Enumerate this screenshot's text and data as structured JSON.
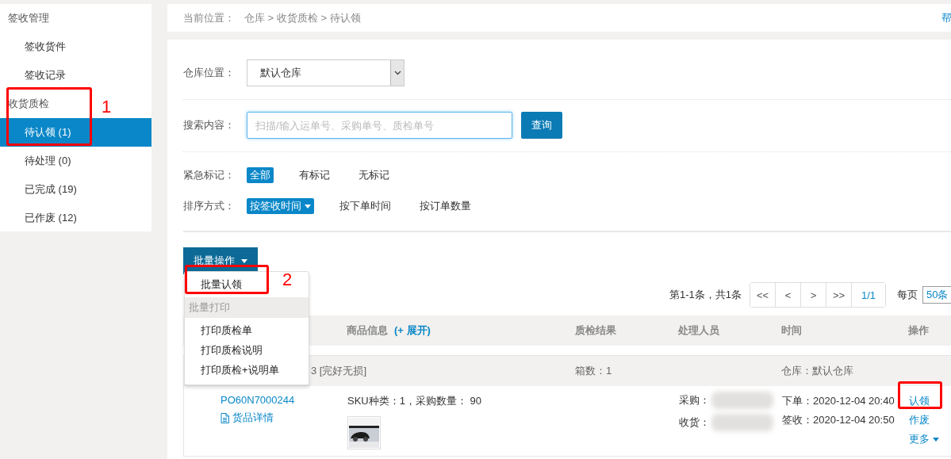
{
  "sidebar": {
    "sections": [
      {
        "title": "签收管理",
        "items": [
          {
            "label": "签收货件",
            "selected": false
          },
          {
            "label": "签收记录",
            "selected": false
          }
        ]
      },
      {
        "title": "收货质检",
        "items": [
          {
            "label": "待认领 (1)",
            "selected": true
          },
          {
            "label": "待处理 (0)",
            "selected": false
          },
          {
            "label": "已完成 (19)",
            "selected": false
          },
          {
            "label": "已作废 (12)",
            "selected": false
          }
        ]
      }
    ]
  },
  "breadcrumb": {
    "label": "当前位置：",
    "path": "仓库 > 收货质检 > 待认领",
    "help": "帮"
  },
  "filters": {
    "warehouse": {
      "label": "仓库位置：",
      "value": "默认仓库"
    },
    "search": {
      "label": "搜索内容：",
      "placeholder": "扫描/输入运单号、采购单号、质检单号",
      "button": "查询"
    },
    "urgent": {
      "label": "紧急标记：",
      "options": [
        {
          "label": "全部",
          "selected": true
        },
        {
          "label": "有标记",
          "selected": false
        },
        {
          "label": "无标记",
          "selected": false
        }
      ]
    },
    "sort": {
      "label": "排序方式：",
      "options": [
        {
          "label": "按签收时间",
          "selected": true
        },
        {
          "label": "按下单时间",
          "selected": false
        },
        {
          "label": "按订单数量",
          "selected": false
        }
      ]
    }
  },
  "batch": {
    "button": "批量操作",
    "menu": [
      {
        "kind": "item",
        "label": "批量认领"
      },
      {
        "kind": "group",
        "label": "批量打印"
      },
      {
        "kind": "item",
        "label": "打印质检单"
      },
      {
        "kind": "item",
        "label": "打印质检说明"
      },
      {
        "kind": "item",
        "label": "打印质检+说明单"
      }
    ]
  },
  "pagination": {
    "summary": "第1-1条，共1条",
    "buttons": [
      "<<",
      "<",
      ">",
      ">>"
    ],
    "page": "1/1",
    "per_page_label": "每页",
    "per_page": "50条"
  },
  "table": {
    "columns": [
      "商品信息",
      "质检结果",
      "处理人员",
      "时间",
      "操作"
    ],
    "expand": "(+ 展开)",
    "groups": [
      {
        "status": "3  [完好无损]",
        "boxes": "箱数：1",
        "warehouse": "仓库：默认仓库",
        "rows": [
          {
            "order": "PO60N7000244",
            "details": "货品详情",
            "sku": "SKU种类：1，采购数量： 90",
            "buyer_label": "采购：",
            "receiver_label": "收货：",
            "ordered": "下单：2020-12-04 20:40",
            "signed": "签收：2020-12-04 20:50",
            "actions": [
              "认领",
              "作废",
              "更多"
            ]
          }
        ]
      }
    ]
  },
  "annotations": [
    {
      "kind": "numbered",
      "number": "1"
    },
    {
      "kind": "numbered",
      "number": "2"
    },
    {
      "kind": "plain"
    }
  ]
}
